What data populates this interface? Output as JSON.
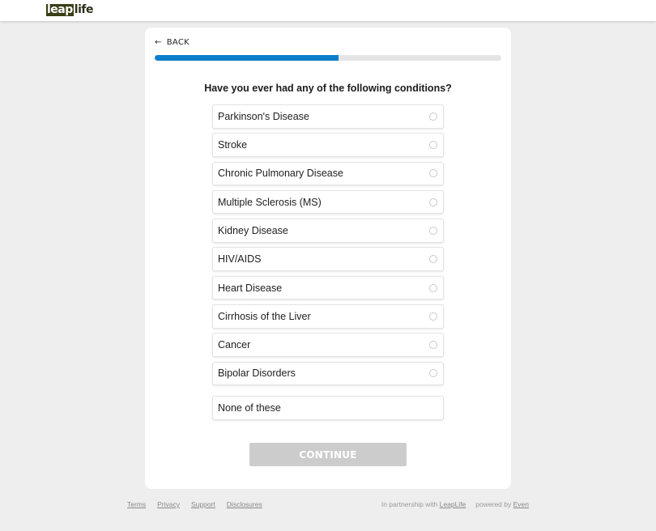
{
  "header": {
    "logo_part1": "leap",
    "logo_part2": "life"
  },
  "nav": {
    "back_label": "BACK",
    "back_icon": "arrow-left-icon"
  },
  "progress": {
    "percent": 53,
    "fill_color": "#0b7fcc"
  },
  "question": {
    "title": "Have you ever had any of the following conditions?",
    "options": [
      {
        "label": "Parkinson's Disease",
        "selected": false
      },
      {
        "label": "Stroke",
        "selected": false
      },
      {
        "label": "Chronic Pulmonary Disease",
        "selected": false
      },
      {
        "label": "Multiple Sclerosis (MS)",
        "selected": false
      },
      {
        "label": "Kidney Disease",
        "selected": false
      },
      {
        "label": "HIV/AIDS",
        "selected": false
      },
      {
        "label": "Heart Disease",
        "selected": false
      },
      {
        "label": "Cirrhosis of the Liver",
        "selected": false
      },
      {
        "label": "Cancer",
        "selected": false
      },
      {
        "label": "Bipolar Disorders",
        "selected": false
      }
    ],
    "none_label": "None of these"
  },
  "actions": {
    "continue_label": "CONTINUE",
    "continue_disabled": true
  },
  "footer": {
    "links": [
      "Terms",
      "Privacy",
      "Support",
      "Disclosures"
    ],
    "partnership_text": "In partnership with",
    "partnership_link": "LeapLife",
    "powered_text": "powered by",
    "powered_link": "Even"
  }
}
